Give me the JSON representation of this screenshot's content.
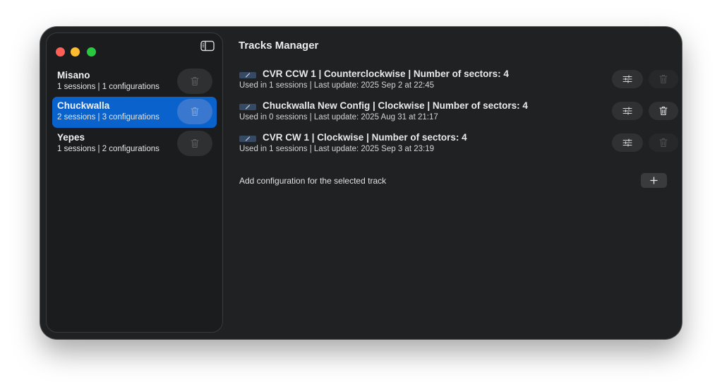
{
  "window": {
    "title": "Tracks Manager"
  },
  "sidebar": {
    "tracks": [
      {
        "name": "Misano",
        "meta": "1 sessions | 1 configurations",
        "selected": false
      },
      {
        "name": "Chuckwalla",
        "meta": "2 sessions | 3 configurations",
        "selected": true
      },
      {
        "name": "Yepes",
        "meta": "1 sessions | 2 configurations",
        "selected": false
      }
    ]
  },
  "main": {
    "configurations": [
      {
        "title": "CVR CCW 1 | Counterclockwise | Number of sectors: 4",
        "meta": "Used in 1 sessions | Last update: 2025 Sep 2 at 22:45",
        "delete_enabled": false
      },
      {
        "title": "Chuckwalla New Config | Clockwise | Number of sectors: 4",
        "meta": "Used in 0 sessions | Last update: 2025 Aug 31 at 21:17",
        "delete_enabled": true
      },
      {
        "title": "CVR CW 1 | Clockwise | Number of sectors: 4",
        "meta": "Used in 1 sessions | Last update: 2025 Sep 3 at 23:19",
        "delete_enabled": false
      }
    ],
    "add_label": "Add configuration for the selected track"
  },
  "colors": {
    "accent": "#0a62cc",
    "window_bg": "#1f2122",
    "sidebar_bg": "#1b1c1d",
    "traffic_red": "#fe5f57",
    "traffic_yellow": "#febc2e",
    "traffic_green": "#28c840"
  },
  "icons": {
    "sidebar_toggle": "sidebar-left-icon",
    "delete": "trash-icon",
    "settings": "sliders-icon",
    "edit": "pencil-icon",
    "add": "plus-icon"
  }
}
